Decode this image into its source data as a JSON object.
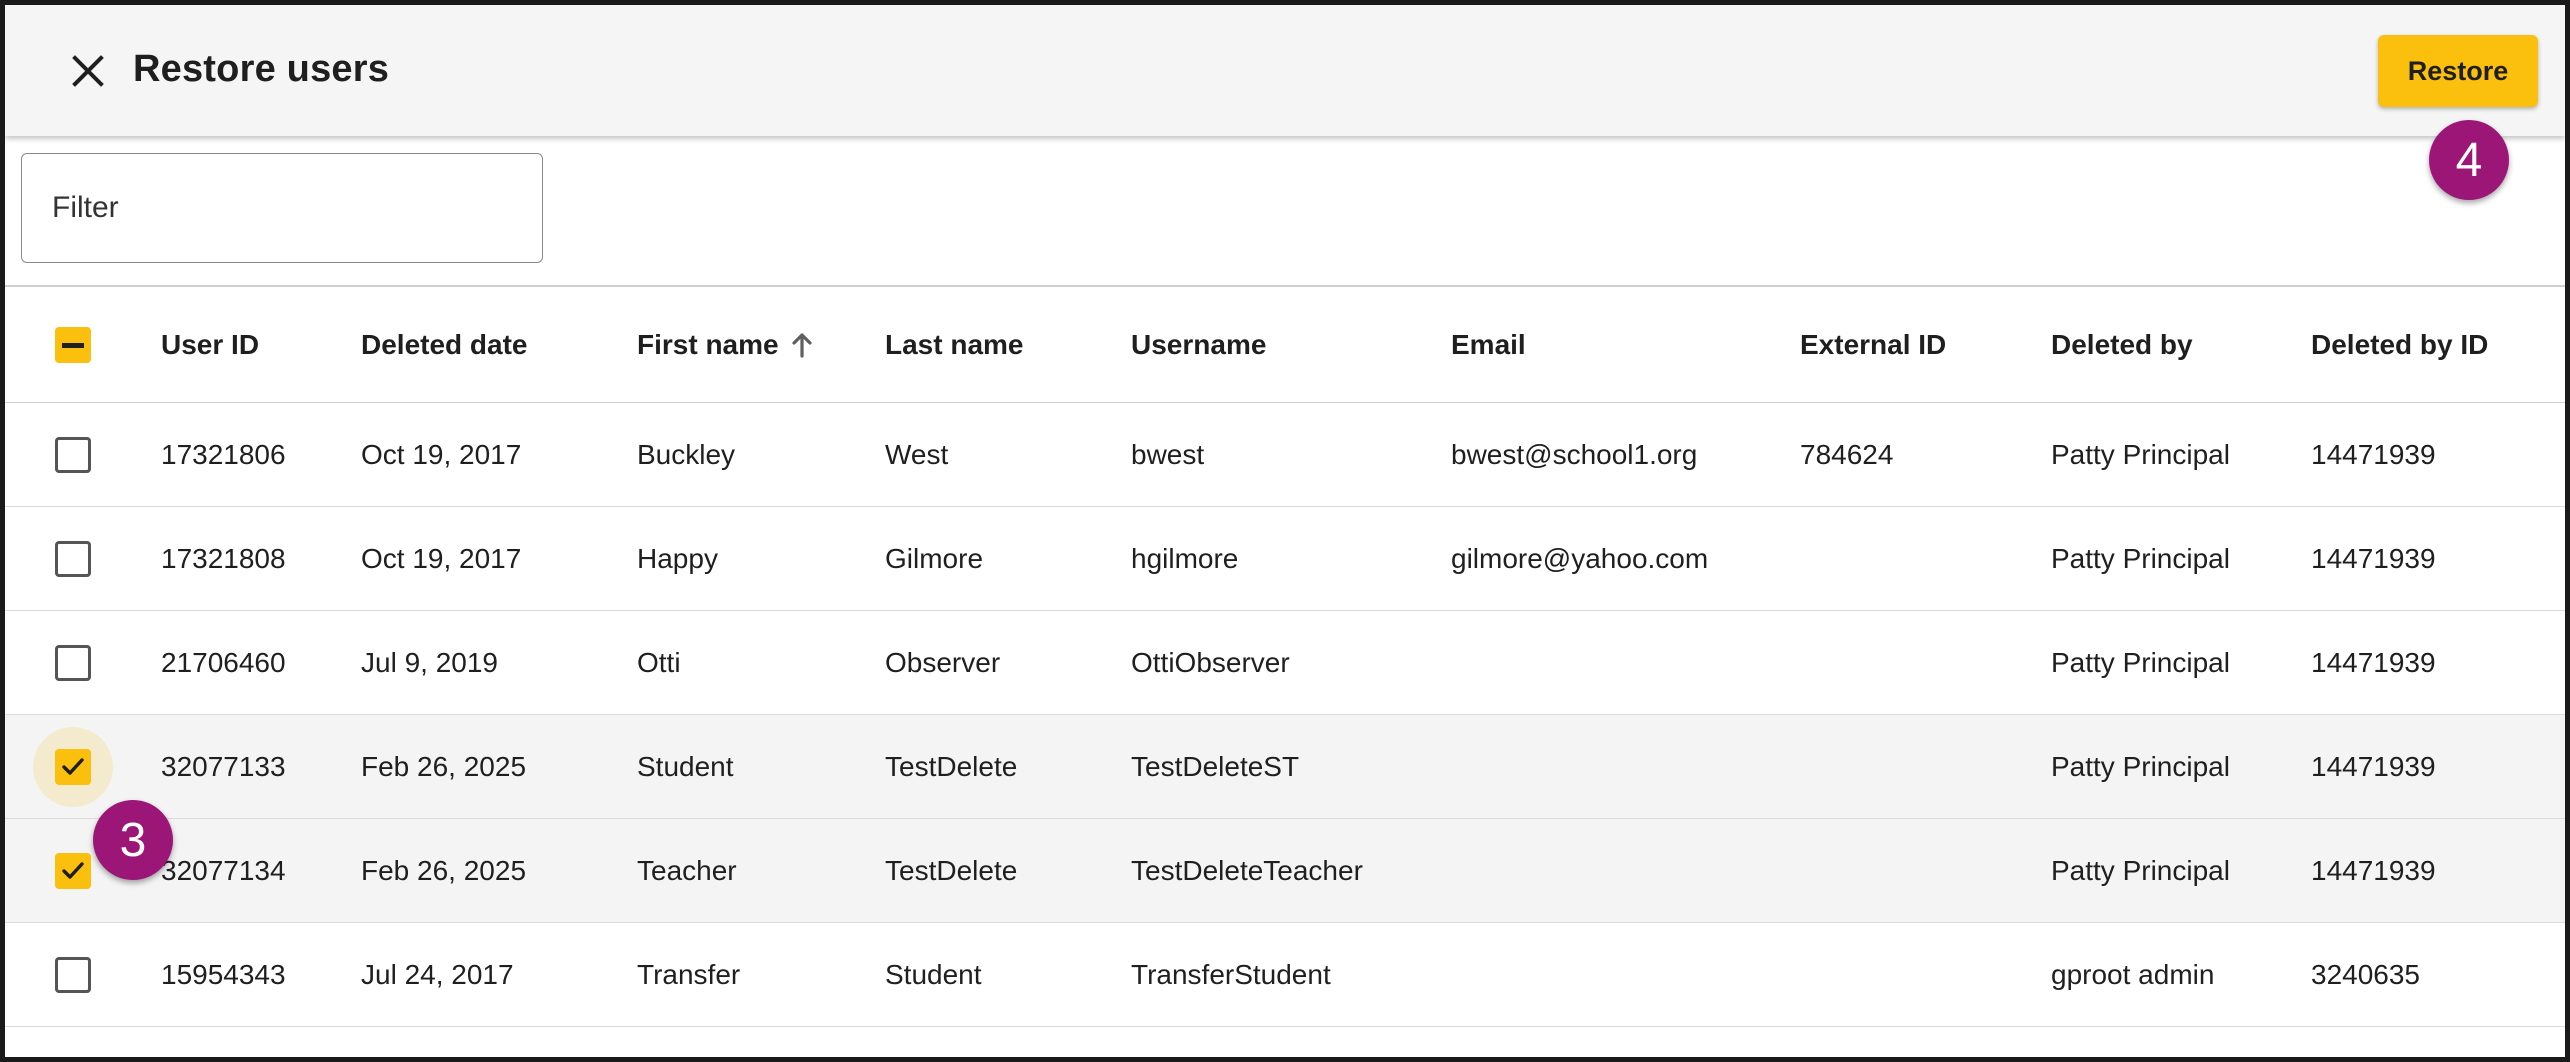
{
  "header": {
    "title": "Restore users",
    "restore_label": "Restore"
  },
  "filter": {
    "placeholder": "Filter"
  },
  "badges": {
    "step3": "3",
    "step4": "4"
  },
  "colors": {
    "accent": "#fbbf0e",
    "badge": "#9c1677"
  },
  "icons": {
    "close": "close-icon",
    "sort": "arrow-up-icon",
    "check": "check-icon",
    "indeterminate": "minus-icon"
  },
  "table": {
    "columns": [
      "User ID",
      "Deleted date",
      "First name",
      "Last name",
      "Username",
      "Email",
      "External ID",
      "Deleted by",
      "Deleted by ID"
    ],
    "sorted_column": "First name",
    "sort_direction": "ascending",
    "select_all_state": "indeterminate",
    "rows": [
      {
        "checked": false,
        "user_id": "17321806",
        "deleted_date": "Oct 19, 2017",
        "first_name": "Buckley",
        "last_name": "West",
        "username": "bwest",
        "email": "bwest@school1.org",
        "external_id": "784624",
        "deleted_by": "Patty Principal",
        "deleted_by_id": "14471939"
      },
      {
        "checked": false,
        "user_id": "17321808",
        "deleted_date": "Oct 19, 2017",
        "first_name": "Happy",
        "last_name": "Gilmore",
        "username": "hgilmore",
        "email": "gilmore@yahoo.com",
        "external_id": "",
        "deleted_by": "Patty Principal",
        "deleted_by_id": "14471939"
      },
      {
        "checked": false,
        "user_id": "21706460",
        "deleted_date": "Jul 9, 2019",
        "first_name": "Otti",
        "last_name": "Observer",
        "username": "OttiObserver",
        "email": "",
        "external_id": "",
        "deleted_by": "Patty Principal",
        "deleted_by_id": "14471939"
      },
      {
        "checked": true,
        "user_id": "32077133",
        "deleted_date": "Feb 26, 2025",
        "first_name": "Student",
        "last_name": "TestDelete",
        "username": "TestDeleteST",
        "email": "",
        "external_id": "",
        "deleted_by": "Patty Principal",
        "deleted_by_id": "14471939"
      },
      {
        "checked": true,
        "user_id": "32077134",
        "deleted_date": "Feb 26, 2025",
        "first_name": "Teacher",
        "last_name": "TestDelete",
        "username": "TestDeleteTeacher",
        "email": "",
        "external_id": "",
        "deleted_by": "Patty Principal",
        "deleted_by_id": "14471939"
      },
      {
        "checked": false,
        "user_id": "15954343",
        "deleted_date": "Jul 24, 2017",
        "first_name": "Transfer",
        "last_name": "Student",
        "username": "TransferStudent",
        "email": "",
        "external_id": "",
        "deleted_by": "gproot admin",
        "deleted_by_id": "3240635"
      }
    ]
  }
}
